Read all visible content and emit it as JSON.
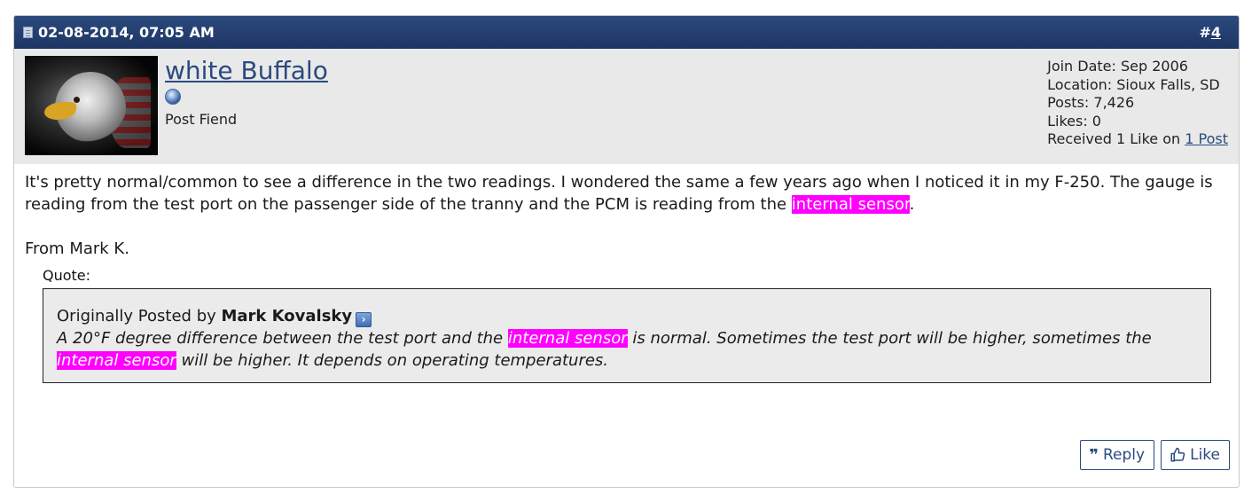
{
  "post": {
    "date": "02-08-2014, 07:05 AM",
    "number_prefix": "#",
    "number": "4"
  },
  "user": {
    "name": "white Buffalo",
    "title": "Post Fiend",
    "join_date": "Join Date: Sep 2006",
    "location": "Location: Sioux Falls, SD",
    "posts": "Posts: 7,426",
    "likes": "Likes: 0",
    "received_prefix": "Received 1 Like on ",
    "received_link": "1 Post"
  },
  "body": {
    "line1_pre": "It's pretty normal/common to see a difference in the two readings. I wondered the same a few years ago when I noticed it in my F-250. The gauge is reading from the test port on the passenger side of the tranny and the PCM is reading from the ",
    "highlight1": "internal sensor",
    "line1_post": ".",
    "from": "From Mark K."
  },
  "quote": {
    "label": "Quote:",
    "originally_posted_by": "Originally Posted by ",
    "author": "Mark Kovalsky",
    "text_a": "A 20°F degree difference between the test port and the ",
    "highlight_a": "internal sensor",
    "text_b": " is normal. Sometimes the test port will be higher, sometimes the ",
    "highlight_b": "internal sensor",
    "text_c": " will be higher. It depends on operating temperatures."
  },
  "actions": {
    "reply_label": "Reply",
    "like_label": "Like"
  },
  "colors": {
    "header_bg": "#1d3564",
    "highlight": "#ff00ff",
    "link": "#2a4a80"
  }
}
